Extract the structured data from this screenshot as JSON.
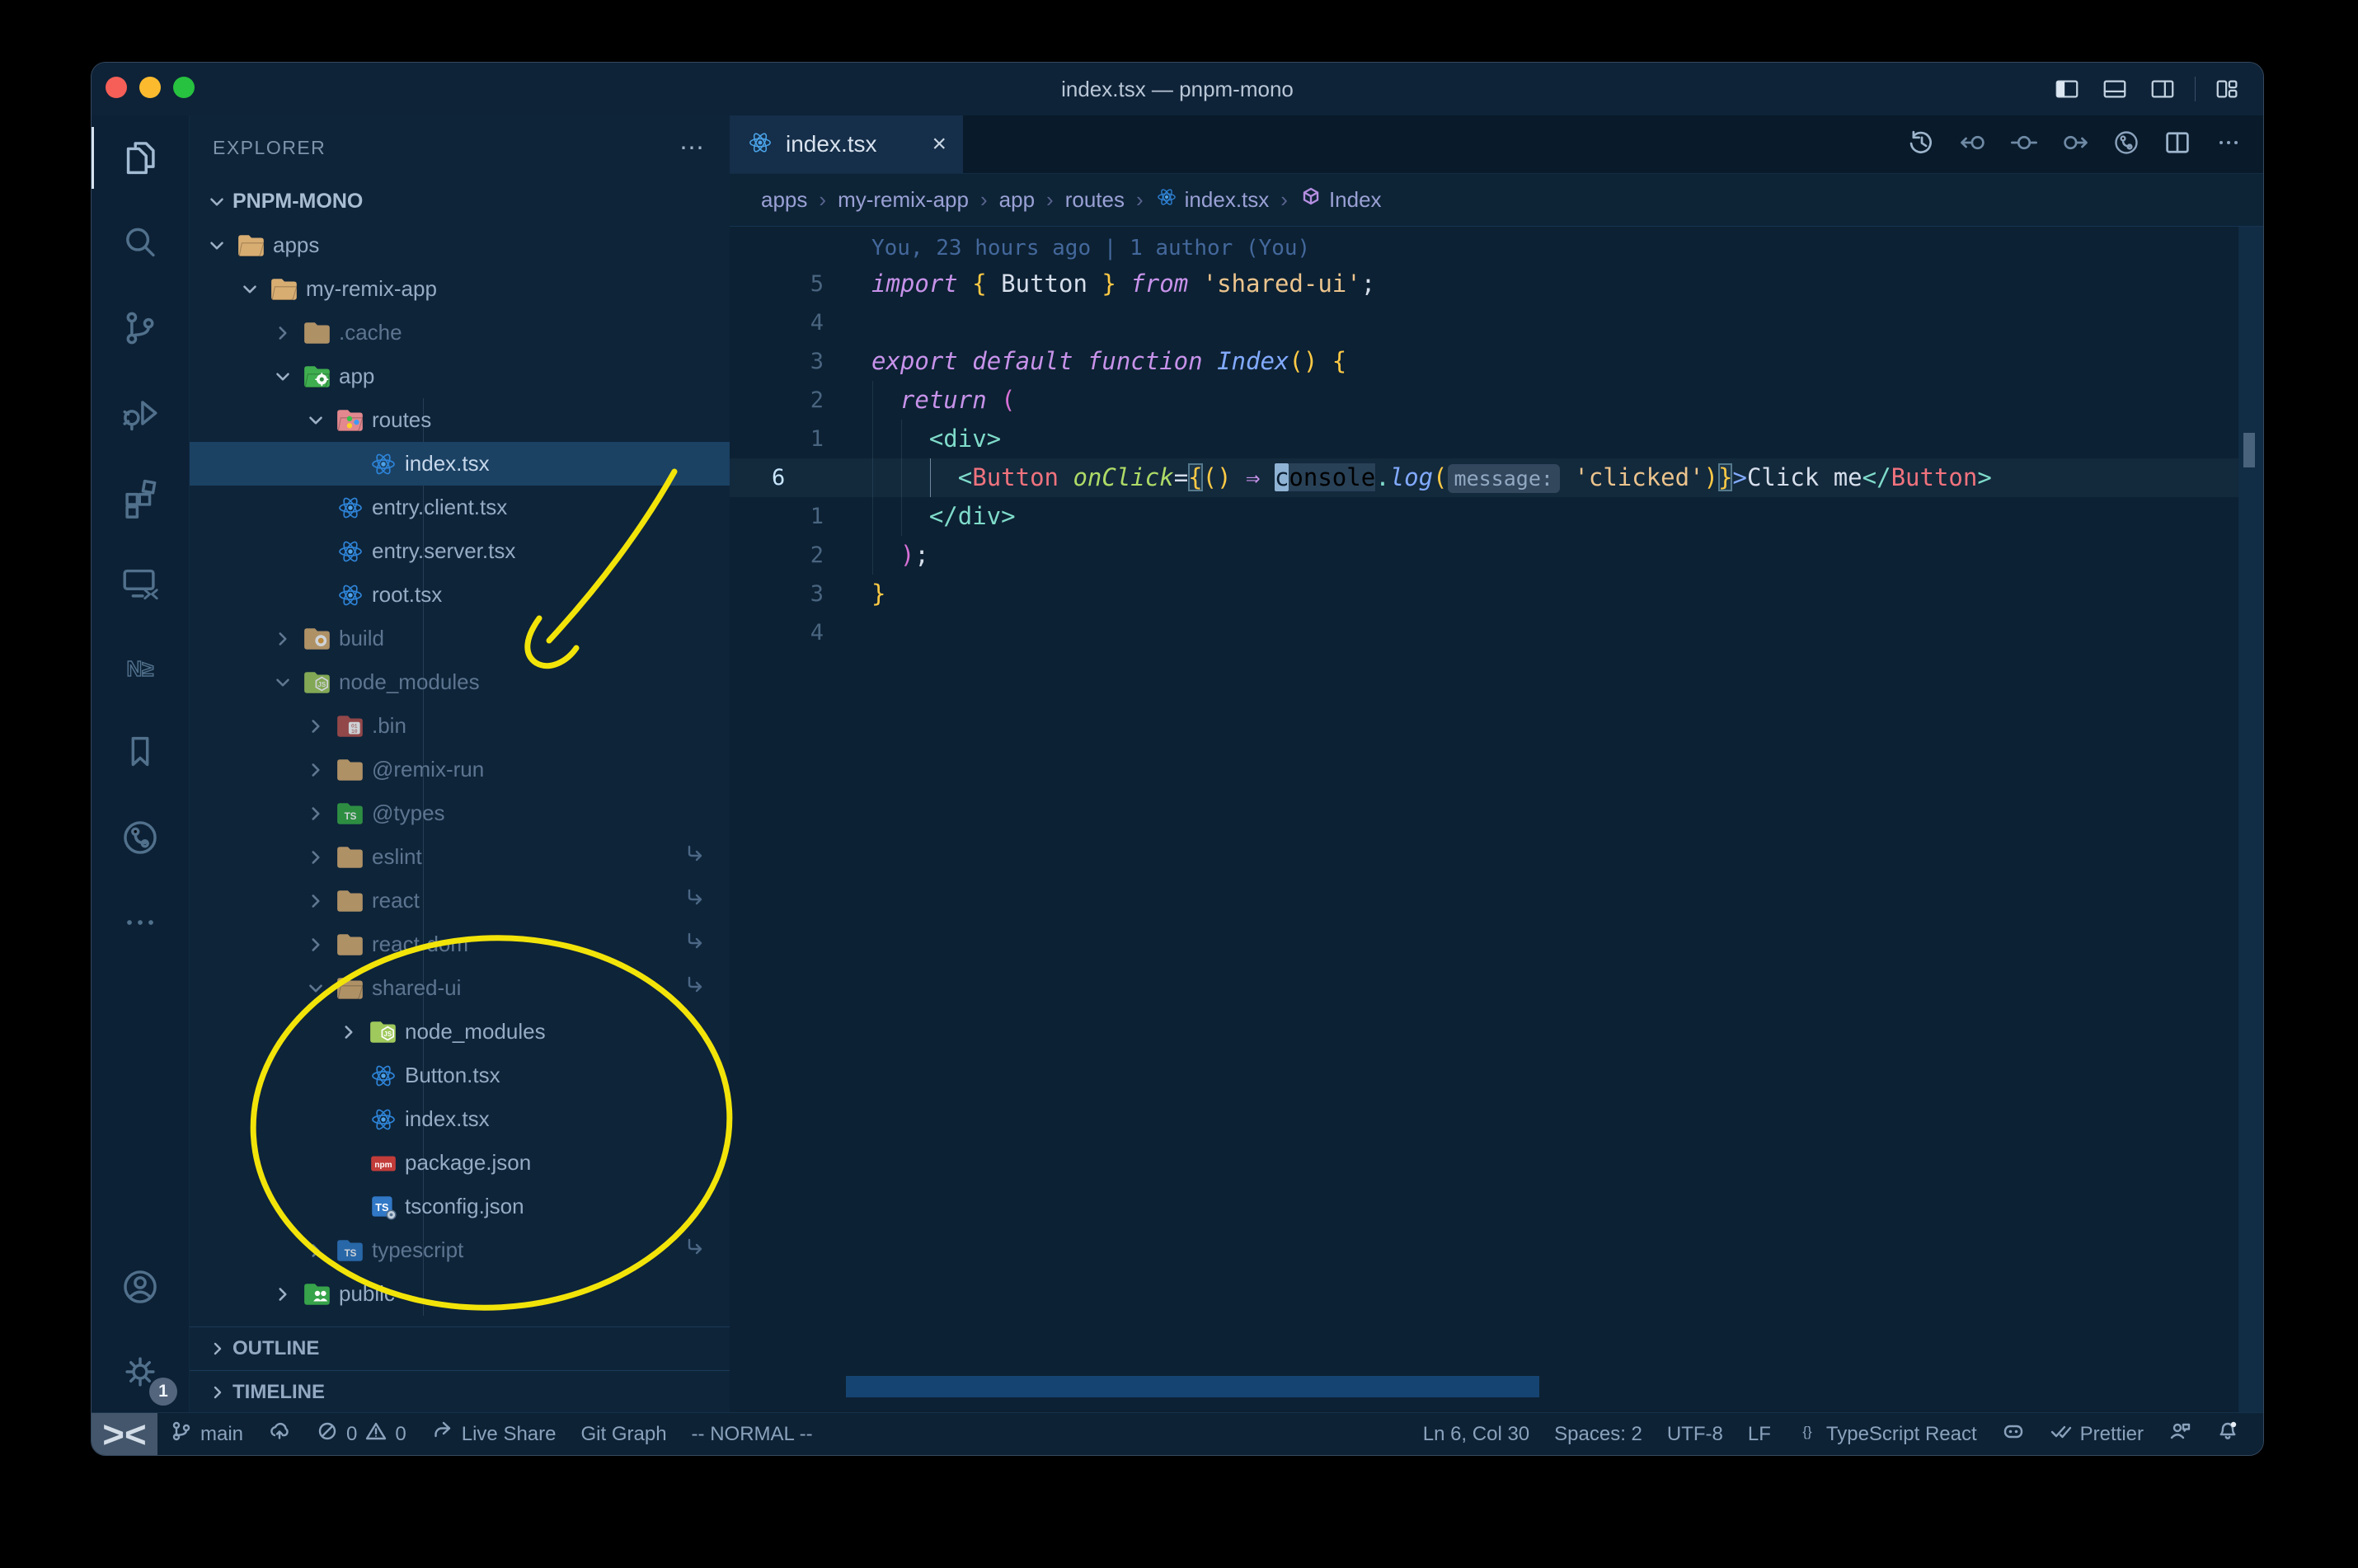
{
  "window": {
    "title": "index.tsx — pnpm-mono"
  },
  "titlebar_icons": [
    {
      "name": "toggle-primary-sidebar-icon",
      "icon": "layout-left"
    },
    {
      "name": "toggle-panel-icon",
      "icon": "layout-bottom"
    },
    {
      "name": "toggle-secondary-sidebar-icon",
      "icon": "layout-right"
    },
    {
      "name": "customize-layout-icon",
      "icon": "layout-grid"
    }
  ],
  "activity_bar": {
    "items": [
      {
        "name": "explorer",
        "icon": "files",
        "active": true
      },
      {
        "name": "search",
        "icon": "search"
      },
      {
        "name": "source-control",
        "icon": "scm"
      },
      {
        "name": "run-and-debug",
        "icon": "debug"
      },
      {
        "name": "extensions",
        "icon": "extensions"
      },
      {
        "name": "remote-explorer",
        "icon": "remote"
      },
      {
        "name": "nx-console",
        "icon": "nx"
      },
      {
        "name": "bookmarks",
        "icon": "bookmark"
      },
      {
        "name": "git-graph",
        "icon": "gitgraph"
      },
      {
        "name": "more-views",
        "icon": "more"
      },
      {
        "name": "accounts",
        "icon": "account",
        "bottom": true
      },
      {
        "name": "settings",
        "icon": "gear",
        "bottom": true,
        "badge": "1"
      }
    ]
  },
  "explorer": {
    "header": "EXPLORER",
    "actions_label": "⋯",
    "root": "PNPM-MONO",
    "outline_label": "OUTLINE",
    "timeline_label": "TIMELINE",
    "tree": [
      {
        "label": "apps",
        "level": 1,
        "icon": "folder-open",
        "chevron": "down"
      },
      {
        "label": "my-remix-app",
        "level": 2,
        "icon": "folder-open",
        "chevron": "down"
      },
      {
        "label": ".cache",
        "level": 3,
        "icon": "folder",
        "chevron": "right",
        "dim": true
      },
      {
        "label": "app",
        "level": 3,
        "icon": "folder-app",
        "chevron": "down"
      },
      {
        "label": "routes",
        "level": 4,
        "icon": "folder-routes",
        "chevron": "down"
      },
      {
        "label": "index.tsx",
        "level": 5,
        "icon": "react",
        "selected": true
      },
      {
        "label": "entry.client.tsx",
        "level": 4,
        "icon": "react"
      },
      {
        "label": "entry.server.tsx",
        "level": 4,
        "icon": "react"
      },
      {
        "label": "root.tsx",
        "level": 4,
        "icon": "react"
      },
      {
        "label": "build",
        "level": 3,
        "icon": "folder-build",
        "chevron": "right",
        "dim": true
      },
      {
        "label": "node_modules",
        "level": 3,
        "icon": "folder-node",
        "chevron": "down",
        "dim": true
      },
      {
        "label": ".bin",
        "level": 4,
        "icon": "folder-bin",
        "chevron": "right",
        "dim": true
      },
      {
        "label": "@remix-run",
        "level": 4,
        "icon": "folder",
        "chevron": "right",
        "dim": true
      },
      {
        "label": "@types",
        "level": 4,
        "icon": "folder-types",
        "chevron": "right",
        "dim": true
      },
      {
        "label": "eslint",
        "level": 4,
        "icon": "folder",
        "chevron": "right",
        "dim": true,
        "symlink": true
      },
      {
        "label": "react",
        "level": 4,
        "icon": "folder",
        "chevron": "right",
        "dim": true,
        "symlink": true
      },
      {
        "label": "react-dom",
        "level": 4,
        "icon": "folder",
        "chevron": "right",
        "dim": true,
        "symlink": true
      },
      {
        "label": "shared-ui",
        "level": 4,
        "icon": "folder-open",
        "chevron": "down",
        "dim": true,
        "symlink": true
      },
      {
        "label": "node_modules",
        "level": 5,
        "icon": "folder-node",
        "chevron": "right"
      },
      {
        "label": "Button.tsx",
        "level": 5,
        "icon": "react"
      },
      {
        "label": "index.tsx",
        "level": 5,
        "icon": "react"
      },
      {
        "label": "package.json",
        "level": 5,
        "icon": "npm"
      },
      {
        "label": "tsconfig.json",
        "level": 5,
        "icon": "tsconfig"
      },
      {
        "label": "typescript",
        "level": 4,
        "icon": "folder-ts",
        "chevron": "right",
        "dim": true,
        "symlink": true
      },
      {
        "label": "public",
        "level": 3,
        "icon": "folder-public",
        "chevron": "right"
      }
    ]
  },
  "tab": {
    "label": "index.tsx",
    "close_label": "×"
  },
  "editor_toolbar": [
    {
      "name": "timeline-history-icon",
      "icon": "history"
    },
    {
      "name": "navigate-back-icon",
      "icon": "navback"
    },
    {
      "name": "navigate-location-icon",
      "icon": "navdot"
    },
    {
      "name": "navigate-forward-icon",
      "icon": "navfwd"
    },
    {
      "name": "git-graph-icon",
      "icon": "gitgraph"
    },
    {
      "name": "split-editor-icon",
      "icon": "split"
    },
    {
      "name": "more-actions-icon",
      "icon": "more"
    }
  ],
  "breadcrumbs": {
    "items": [
      {
        "label": "apps"
      },
      {
        "label": "my-remix-app"
      },
      {
        "label": "app"
      },
      {
        "label": "routes"
      },
      {
        "label": "index.tsx",
        "icon": "react"
      },
      {
        "label": "Index",
        "icon": "cube"
      }
    ],
    "separator": "›"
  },
  "editor": {
    "blame": "You, 23 hours ago | 1 author (You)",
    "code_rows": [
      {
        "num": "5",
        "tokens": [
          {
            "t": "import",
            "c": "kw"
          },
          {
            "t": " ",
            "c": "txt"
          },
          {
            "t": "{",
            "c": "b1"
          },
          {
            "t": " Button ",
            "c": "txt"
          },
          {
            "t": "}",
            "c": "b1"
          },
          {
            "t": " ",
            "c": "txt"
          },
          {
            "t": "from",
            "c": "kw"
          },
          {
            "t": " ",
            "c": "txt"
          },
          {
            "t": "'shared-ui'",
            "c": "str"
          },
          {
            "t": ";",
            "c": "txt"
          }
        ]
      },
      {
        "num": "4",
        "tokens": []
      },
      {
        "num": "3",
        "tokens": [
          {
            "t": "export",
            "c": "kw"
          },
          {
            "t": " ",
            "c": "txt"
          },
          {
            "t": "default",
            "c": "kw"
          },
          {
            "t": " ",
            "c": "txt"
          },
          {
            "t": "function",
            "c": "kw"
          },
          {
            "t": " ",
            "c": "txt"
          },
          {
            "t": "Index",
            "c": "fn"
          },
          {
            "t": "()",
            "c": "b1"
          },
          {
            "t": " ",
            "c": "txt"
          },
          {
            "t": "{",
            "c": "b1"
          }
        ]
      },
      {
        "num": "2",
        "tokens": [
          {
            "t": "  ",
            "c": "txt"
          },
          {
            "t": "return",
            "c": "kw"
          },
          {
            "t": " ",
            "c": "txt"
          },
          {
            "t": "(",
            "c": "b2"
          }
        ]
      },
      {
        "num": "1",
        "tokens": [
          {
            "t": "    ",
            "c": "txt"
          },
          {
            "t": "<div>",
            "c": "tag"
          }
        ]
      },
      {
        "num": "6",
        "current": true,
        "tokens": [
          {
            "t": "      ",
            "c": "txt"
          },
          {
            "t": "<",
            "c": "tag"
          },
          {
            "t": "Button",
            "c": "comp"
          },
          {
            "t": " ",
            "c": "txt"
          },
          {
            "t": "onClick",
            "c": "attr"
          },
          {
            "t": "=",
            "c": "txt"
          },
          {
            "t": "{",
            "c": "bm"
          },
          {
            "t": "()",
            "c": "b1"
          },
          {
            "t": " ",
            "c": "txt"
          },
          {
            "t": "⇒",
            "c": "arrow"
          },
          {
            "t": " ",
            "c": "txt"
          },
          {
            "t": "c",
            "c": "cursor"
          },
          {
            "t": "onsole",
            "c": "whl"
          },
          {
            "t": ".",
            "c": "tag"
          },
          {
            "t": "log",
            "c": "fn"
          },
          {
            "t": "(",
            "c": "b1"
          },
          {
            "t": "message:",
            "c": "hint"
          },
          {
            "t": " ",
            "c": "txt"
          },
          {
            "t": "'clicked'",
            "c": "str"
          },
          {
            "t": ")",
            "c": "b1"
          },
          {
            "t": "}",
            "c": "bm"
          },
          {
            "t": ">",
            "c": "fn"
          },
          {
            "t": "Click me",
            "c": "txt"
          },
          {
            "t": "</",
            "c": "tag"
          },
          {
            "t": "Button",
            "c": "comp"
          },
          {
            "t": ">",
            "c": "tag"
          }
        ]
      },
      {
        "num": "1",
        "tokens": [
          {
            "t": "    ",
            "c": "txt"
          },
          {
            "t": "</div>",
            "c": "tag"
          }
        ]
      },
      {
        "num": "2",
        "tokens": [
          {
            "t": "  ",
            "c": "txt"
          },
          {
            "t": ")",
            "c": "b2"
          },
          {
            "t": ";",
            "c": "txt"
          }
        ]
      },
      {
        "num": "3",
        "tokens": [
          {
            "t": "}",
            "c": "b1"
          }
        ]
      },
      {
        "num": "4",
        "tokens": []
      }
    ]
  },
  "status_bar": {
    "left": [
      {
        "name": "branch-indicator",
        "icon": "branch",
        "label": "main"
      },
      {
        "name": "sync-changes",
        "icon": "cloud"
      },
      {
        "name": "problems",
        "icon": "err",
        "label": "0",
        "icon2": "warn",
        "label2": "0"
      },
      {
        "name": "live-share",
        "icon": "share",
        "label": "Live Share"
      },
      {
        "name": "git-graph-status",
        "label": "Git Graph"
      },
      {
        "name": "vim-mode",
        "label": "-- NORMAL --"
      }
    ],
    "right": [
      {
        "name": "cursor-position",
        "label": "Ln 6, Col 30"
      },
      {
        "name": "indentation",
        "label": "Spaces: 2"
      },
      {
        "name": "encoding",
        "label": "UTF-8"
      },
      {
        "name": "eol",
        "label": "LF"
      },
      {
        "name": "language-mode",
        "icon": "braces",
        "label": "TypeScript React"
      },
      {
        "name": "copilot",
        "icon": "copilot"
      },
      {
        "name": "formatter-prettier",
        "icon": "checks",
        "label": "Prettier"
      },
      {
        "name": "feedback",
        "icon": "person"
      },
      {
        "name": "notifications",
        "icon": "bell"
      }
    ]
  },
  "colors": {
    "annotation_yellow": "#f2e409",
    "selection_blue": "#1b4163",
    "editor_bg": "#0c2133",
    "accent_purple": "#c792ea"
  }
}
